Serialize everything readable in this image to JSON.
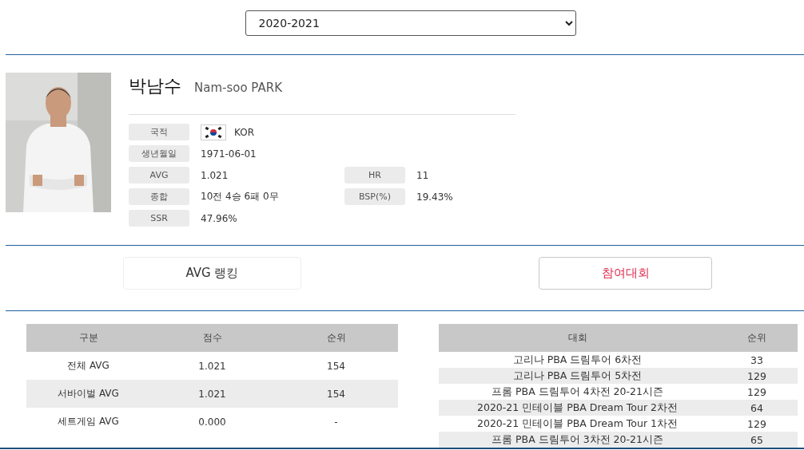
{
  "season_select": {
    "value": "2020-2021"
  },
  "player": {
    "photo": {
      "kind": "picture"
    },
    "name": "박남수",
    "name_en": "Nam-soo PARK",
    "info_rows": [
      [
        {
          "label": "국적",
          "value": "KOR",
          "kind": "flag"
        }
      ],
      [
        {
          "label": "생년월일",
          "value": "1971-06-01",
          "kind": "text"
        }
      ],
      [
        {
          "label": "AVG",
          "value": "1.021",
          "kind": "text"
        },
        {
          "label": "HR",
          "value": "11",
          "kind": "text"
        }
      ],
      [
        {
          "label": "종합",
          "value": "10전 4승 6패 0무",
          "kind": "text"
        },
        {
          "label": "BSP(%)",
          "value": "19.43%",
          "kind": "text"
        }
      ],
      [
        {
          "label": "SSR",
          "value": "47.96%",
          "kind": "text"
        }
      ]
    ]
  },
  "tabs": [
    {
      "label": "AVG 랭킹",
      "selected": false
    },
    {
      "label": "참여대회",
      "selected": true
    }
  ],
  "ranking_table": {
    "columns": [
      "구분",
      "점수",
      "순위"
    ],
    "rows": [
      [
        "전체 AVG",
        "1.021",
        "154"
      ],
      [
        "서바이벌 AVG",
        "1.021",
        "154"
      ],
      [
        "세트게임 AVG",
        "0.000",
        "-"
      ]
    ]
  },
  "tournament_table": {
    "columns": [
      "대회",
      "순위"
    ],
    "rows": [
      [
        "고리나 PBA 드림투어 6차전",
        "33"
      ],
      [
        "고리나 PBA 드림투어 5차전",
        "129"
      ],
      [
        "프롬 PBA 드림투어 4차전 20-21시즌",
        "129"
      ],
      [
        "2020-21 민테이블 PBA Dream Tour 2차전",
        "64"
      ],
      [
        "2020-21 민테이블 PBA Dream Tour 1차전",
        "129"
      ],
      [
        "프롬 PBA 드림투어 3차전 20-21시즌",
        "65"
      ]
    ]
  }
}
